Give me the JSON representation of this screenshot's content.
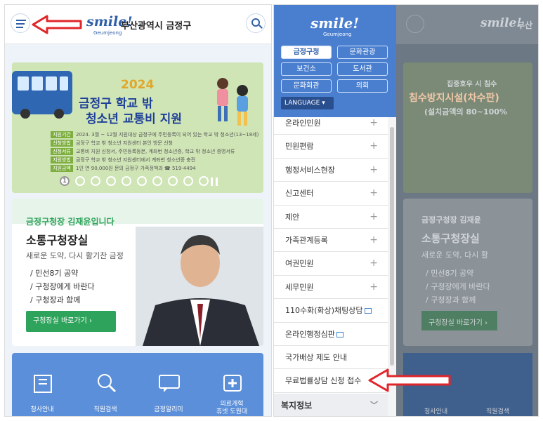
{
  "left": {
    "header": {
      "logo_text": "smile!",
      "logo_sub": "Geumjeong",
      "site_name": "부산광역시 금정구",
      "menu_icon": "hamburger-icon",
      "search_icon": "search-icon"
    },
    "banner": {
      "year": "2024",
      "title_line1": "금정구 학교 밖",
      "title_line2": "청소년 교통비 지원",
      "info": [
        {
          "label": "지원기간",
          "text": "2024. 3월 ~ 12월   지원대상  금정구에 주민등록이 되어 있는 학교 밖 청소년(13~18세)"
        },
        {
          "label": "신청방법",
          "text": "금정구 학교 밖 청소년 지원센터 본인 방문 신청"
        },
        {
          "label": "신청서류",
          "text": "교통비 지원 신청서, 주민등록등본, 계좌번 청소년증, 학교 밖 청소년 증명서류"
        },
        {
          "label": "지원방법",
          "text": "금정구 학교 밖 청소년 지원센터에서 계좌번 청소년증 충전"
        },
        {
          "label": "지원금액",
          "text": "1인 연 90,000원   문의  금정구 가족정책과 ☎ 519-4494"
        }
      ],
      "current_slide": "1",
      "slide_count": 10
    },
    "mayor": {
      "kicker": "금정구청장 김재윤입니다",
      "title": "소통구청장실",
      "subtitle": "새로운 도약, 다시 활기찬 금정",
      "items": [
        "민선8기 공약",
        "구청장에게 바란다",
        "구청장과 함께"
      ],
      "button": "구청장실 바로가기 ›"
    },
    "quick_menu": [
      {
        "label": "청사안내",
        "icon": "building-icon"
      },
      {
        "label": "직원검색",
        "icon": "person-search-icon"
      },
      {
        "label": "금정알리미",
        "icon": "chat-board-icon"
      },
      {
        "label": "의료개혁\n휴넷 도원대",
        "icon": "medical-icon"
      }
    ]
  },
  "right": {
    "drawer": {
      "logo_text": "smile!",
      "logo_sub": "Geumjeong",
      "tabs": [
        "금정구청",
        "문화관광",
        "보건소",
        "도서관",
        "문화회관",
        "의회"
      ],
      "active_tab": "금정구청",
      "language": "LANGUAGE ▾",
      "menu_items": [
        {
          "label": "온라인민원",
          "type": "plus"
        },
        {
          "label": "민원편람",
          "type": "plus"
        },
        {
          "label": "행정서비스현장",
          "type": "plus"
        },
        {
          "label": "신고센터",
          "type": "plus"
        },
        {
          "label": "제안",
          "type": "plus"
        },
        {
          "label": "가족관계등록",
          "type": "plus"
        },
        {
          "label": "여권민원",
          "type": "plus"
        },
        {
          "label": "세무민원",
          "type": "plus"
        },
        {
          "label": "110수화(화상)채팅상담",
          "type": "external"
        },
        {
          "label": "온라인행정심판",
          "type": "external"
        },
        {
          "label": "국가배상 제도 안내",
          "type": "none"
        },
        {
          "label": "무료법률상담 신청 접수",
          "type": "none"
        }
      ],
      "section": "복지정보",
      "section_icon": "chevron-down-icon"
    },
    "background": {
      "logo_text": "smile!",
      "site_name": "부산",
      "banner_title": "침수방지시설(차수판)",
      "banner_kicker": "집중호우 시 침수",
      "banner_sub": "(설치금액의 80~100%",
      "mayor_kicker": "금정구청장 김재윤",
      "mayor_title": "소통구청장실",
      "mayor_sub": "새로운 도약, 다시 활",
      "mayor_items": [
        "민선8기 공약",
        "구청장에게 바란다",
        "구청장과 함께"
      ],
      "mayor_button": "구청장실 바로가기 ›",
      "quick_labels": [
        "청사안내",
        "직원검색"
      ]
    }
  },
  "colors": {
    "accent": "#2f5fa8",
    "arrow": "#e0262b",
    "green": "#2ea35b",
    "drawer": "#4a7fd0"
  }
}
